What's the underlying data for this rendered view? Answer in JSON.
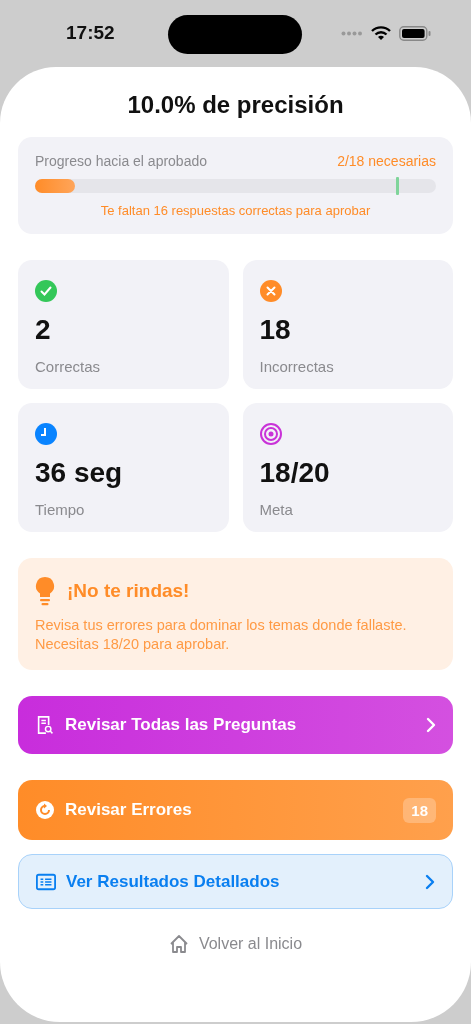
{
  "status_bar": {
    "time": "17:52"
  },
  "title": "10.0% de precisión",
  "progress": {
    "label": "Progreso hacia el aprobado",
    "count": "2/18 necesarias",
    "level": 0.1,
    "pass_mark": {
      "level": 0.9
    },
    "hint": "Te faltan 16 respuestas correctas para aprobar"
  },
  "stats": [
    {
      "kind": "check",
      "color": "#34c759",
      "value": "2",
      "label": "Correctas"
    },
    {
      "kind": "cross",
      "color": "#ff8c28",
      "value": "18",
      "label": "Incorrectas"
    },
    {
      "kind": "clock",
      "color": "#0a84ff",
      "value": "36 seg",
      "label": "Tiempo"
    },
    {
      "kind": "target",
      "color": "#c932d8",
      "value": "18/20",
      "label": "Meta"
    }
  ],
  "tip": {
    "title": "¡No te rindas!",
    "text": "Revisa tus errores para dominar los temas donde fallaste. Necesitas 18/20 para aprobar."
  },
  "actions": [
    {
      "kind": "review-all",
      "label": "Revisar Todas las Preguntas"
    },
    {
      "kind": "review-errors",
      "label": "Revisar Errores",
      "badge": "18"
    },
    {
      "kind": "details",
      "label": "Ver Resultados Detallados"
    }
  ],
  "home_link": "Volver al Inicio"
}
